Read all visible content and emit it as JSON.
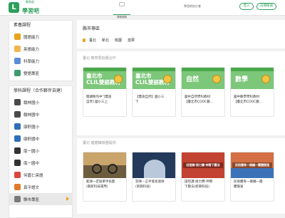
{
  "header": {
    "brand_sub": "教育部",
    "brand_name": "學習吧",
    "logo_letter": "L",
    "center_tab": "課程總覽",
    "top_link": "學習吧加分會",
    "login": "登入",
    "register": "註冊帳號"
  },
  "sidebar": {
    "section1_title": "素養課程",
    "section1_items": [
      {
        "label": "國語能力",
        "icon": "book-icon",
        "color": "#e8a21b"
      },
      {
        "label": "英語能力",
        "icon": "book-icon",
        "color": "#f0b64a"
      },
      {
        "label": "科學能力",
        "icon": "atom-icon",
        "color": "#5b8dd6"
      },
      {
        "label": "雙語專區",
        "icon": "language-icon",
        "color": "#3e9b6b"
      }
    ],
    "section2_title": "學科課程（合作夥伴自建）",
    "section2_items": [
      {
        "label": "翰林國小",
        "icon": "publisher-icon",
        "color": "#4a4a4a"
      },
      {
        "label": "翰林國中",
        "icon": "publisher-icon",
        "color": "#4a4a4a"
      },
      {
        "label": "康軒國小",
        "icon": "publisher-icon",
        "color": "#2f6fb8"
      },
      {
        "label": "康軒國中",
        "icon": "publisher-icon",
        "color": "#2f6fb8"
      },
      {
        "label": "南一國小",
        "icon": "publisher-icon",
        "color": "#333333"
      },
      {
        "label": "南一國中",
        "icon": "publisher-icon",
        "color": "#333333"
      },
      {
        "label": "何嘉仁英語",
        "icon": "publisher-icon",
        "color": "#d9463c"
      },
      {
        "label": "真平語文",
        "icon": "publisher-icon",
        "color": "#e07a2a"
      },
      {
        "label": "縣市專區",
        "icon": "region-icon",
        "color": "#7a7a7a"
      }
    ]
  },
  "main": {
    "title": "縣市專區",
    "chips": [
      "臺北",
      "新北",
      "桃園",
      "苗栗"
    ],
    "section1_title": "臺北 教育局授權合作",
    "section1_cards": [
      {
        "thumb_title": "臺北市\nCLIL雙語教材",
        "text": "閱讀製作中\"[雙語\n自然] 國小三上"
      },
      {
        "thumb_title": "臺北市\nCLIL雙語教材",
        "text": "【雙語自然】國小三\n下"
      },
      {
        "thumb_title": "自然",
        "text": "國中自然學科教材\n【臺北市COOC數..."
      },
      {
        "thumb_title": "數學",
        "text": "國中數學學科教材\n【臺北市COOC數..."
      }
    ],
    "section2_title": "臺北 健體輔導團提供",
    "section2_cards": [
      {
        "style": "cycle",
        "thumb_label": "",
        "text": "藍球一定點單手投籃\n(興新科技運用)"
      },
      {
        "style": "bubble",
        "thumb_label": "",
        "text": "羽球－正手發高遠球\n(新興科技)"
      },
      {
        "style": "red",
        "thumb_label": "田徑課-接力賽-伸臂下壓法",
        "text": "田徑課-接力賽-伸臂\n下壓法(新興科技)"
      },
      {
        "style": "track",
        "thumb_label": "民俗體育一跳繩一團體競速",
        "text": "民俗體育一跳繩一團\n體競速"
      }
    ]
  }
}
